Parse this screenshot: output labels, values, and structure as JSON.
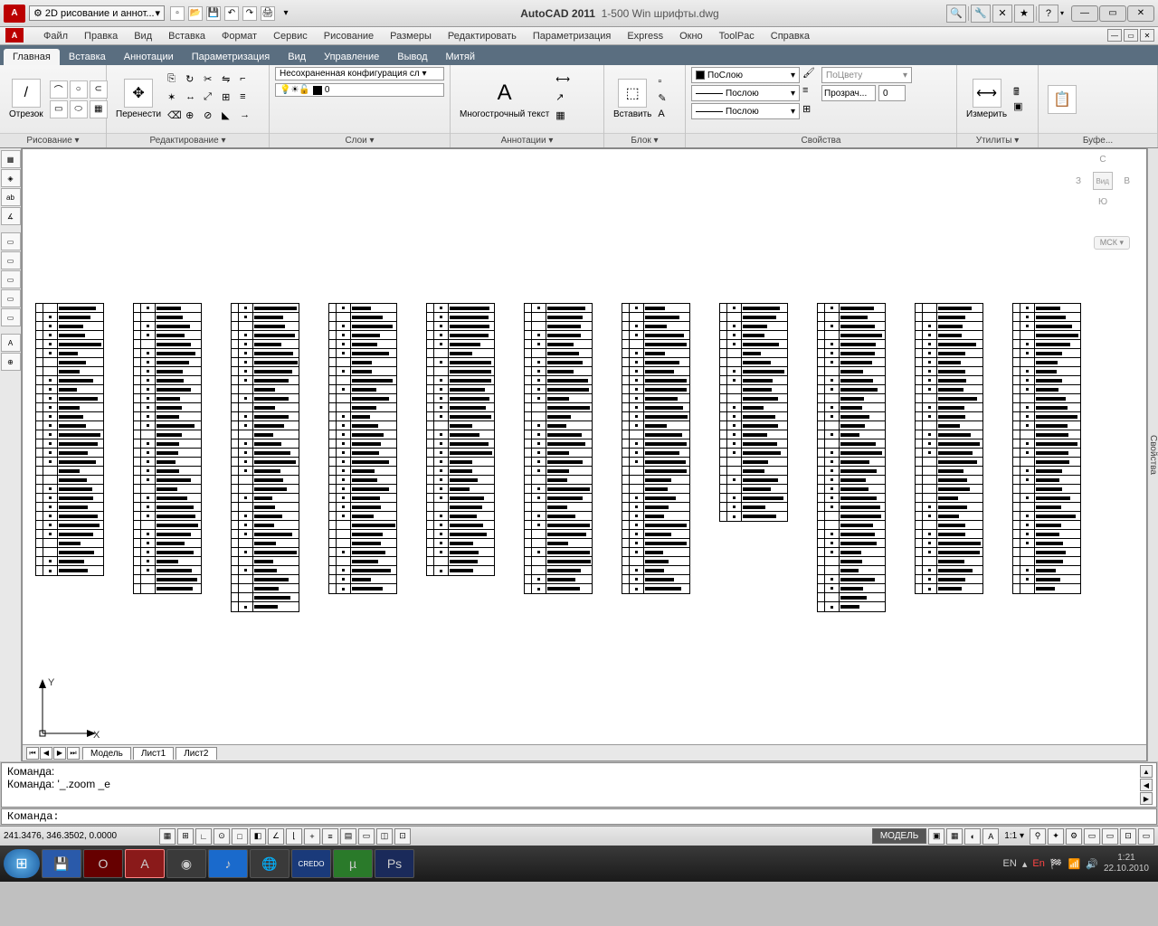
{
  "titlebar": {
    "logo_text": "A",
    "workspace": "2D рисование и аннот...",
    "app": "AutoCAD 2011",
    "file": "1-500 Win шрифты.dwg",
    "qat_icons": [
      "new",
      "open",
      "save",
      "undo",
      "redo",
      "print"
    ]
  },
  "menu": [
    "Файл",
    "Правка",
    "Вид",
    "Вставка",
    "Формат",
    "Сервис",
    "Рисование",
    "Размеры",
    "Редактировать",
    "Параметризация",
    "Express",
    "Окно",
    "ToolPac",
    "Справка"
  ],
  "ribbon_tabs": [
    "Главная",
    "Вставка",
    "Аннотации",
    "Параметризация",
    "Вид",
    "Управление",
    "Вывод",
    "Митяй"
  ],
  "ribbon": {
    "draw": {
      "label": "Рисование ▾",
      "big": "Отрезок"
    },
    "edit": {
      "label": "Редактирование ▾",
      "big": "Перенести",
      "layercfg": "Несохраненная конфигурация сл ▾"
    },
    "layers": {
      "label": "Слои ▾",
      "current": "0"
    },
    "annot": {
      "label": "Аннотации ▾",
      "big": "Многострочный текст",
      "glyph": "A"
    },
    "block": {
      "label": "Блок ▾",
      "big": "Вставить"
    },
    "props": {
      "label": "Свойства",
      "bylayer": "ПоСлою",
      "linetype": "Послою",
      "lineweight": "Послою",
      "bycolor": "ПоЦвету",
      "transp_label": "Прозрач...",
      "transp_val": "0"
    },
    "util": {
      "label": "Утилиты ▾",
      "big": "Измерить"
    },
    "clip": {
      "label": "Буфе..."
    }
  },
  "viewcube": {
    "n": "С",
    "s": "Ю",
    "e": "В",
    "w": "З",
    "face": "Вид",
    "coord": "МСК ▾"
  },
  "layout_tabs": [
    "Модель",
    "Лист1",
    "Лист2"
  ],
  "command_history": [
    "Команда:",
    "Команда: '_.zoom _e"
  ],
  "command_prompt": "Команда:",
  "status": {
    "coords": "241.3476, 346.3502, 0.0000",
    "model": "МОДЕЛЬ",
    "scale": "1:1 ▾"
  },
  "right_panel": "Свойства",
  "axes": {
    "x": "X",
    "y": "Y"
  },
  "tray": {
    "lang": "EN",
    "time": "1:21",
    "date": "22.10.2010"
  },
  "taskbar_apps": [
    "📁",
    "🔴",
    "A",
    "🔵",
    "🎵",
    "🌐",
    "C",
    "⬇",
    "Ps"
  ]
}
